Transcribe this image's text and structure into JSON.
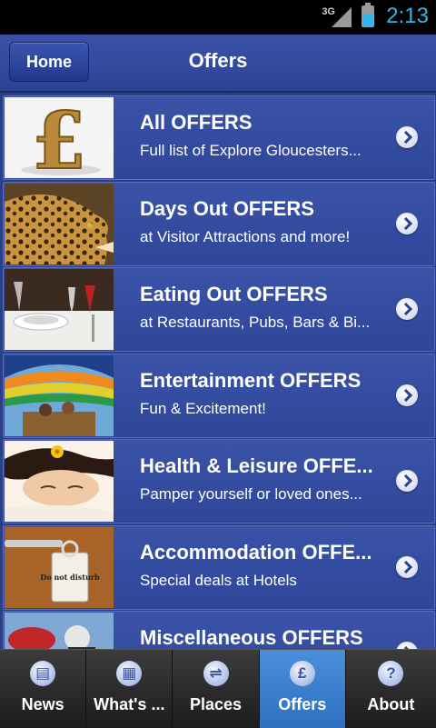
{
  "status_bar": {
    "network": "3G",
    "time": "2:13"
  },
  "header": {
    "home_label": "Home",
    "title": "Offers"
  },
  "offers": [
    {
      "title": "All OFFERS",
      "subtitle": "Full list of Explore Gloucesters...",
      "thumb": "pound-sign"
    },
    {
      "title": "Days Out OFFERS",
      "subtitle": "at Visitor Attractions and more!",
      "thumb": "leopard"
    },
    {
      "title": "Eating Out OFFERS",
      "subtitle": "at Restaurants, Pubs, Bars & Bi...",
      "thumb": "dining-table"
    },
    {
      "title": "Entertainment OFFERS",
      "subtitle": "Fun & Excitement!",
      "thumb": "hot-air-balloon"
    },
    {
      "title": "Health & Leisure OFFE...",
      "subtitle": "Pamper yourself or loved ones...",
      "thumb": "spa-relaxation"
    },
    {
      "title": "Accommodation OFFE...",
      "subtitle": "Special deals at Hotels",
      "thumb": "do-not-disturb-sign"
    },
    {
      "title": "Miscellaneous OFFERS",
      "subtitle": "",
      "thumb": "skydiving"
    }
  ],
  "thumb_text": {
    "do_not_disturb": "Do not disturb"
  },
  "tabs": [
    {
      "label": "News",
      "icon": "news-icon",
      "glyph": "▤",
      "active": false
    },
    {
      "label": "What's ...",
      "icon": "calendar-icon",
      "glyph": "▦",
      "active": false
    },
    {
      "label": "Places",
      "icon": "map-icon",
      "glyph": "⇌",
      "active": false
    },
    {
      "label": "Offers",
      "icon": "pound-icon",
      "glyph": "£",
      "active": true
    },
    {
      "label": "About",
      "icon": "help-icon",
      "glyph": "?",
      "active": false
    }
  ],
  "colors": {
    "accent": "#33b5e5",
    "bar": "#2c4394",
    "active_tab": "#3a7fd0"
  }
}
